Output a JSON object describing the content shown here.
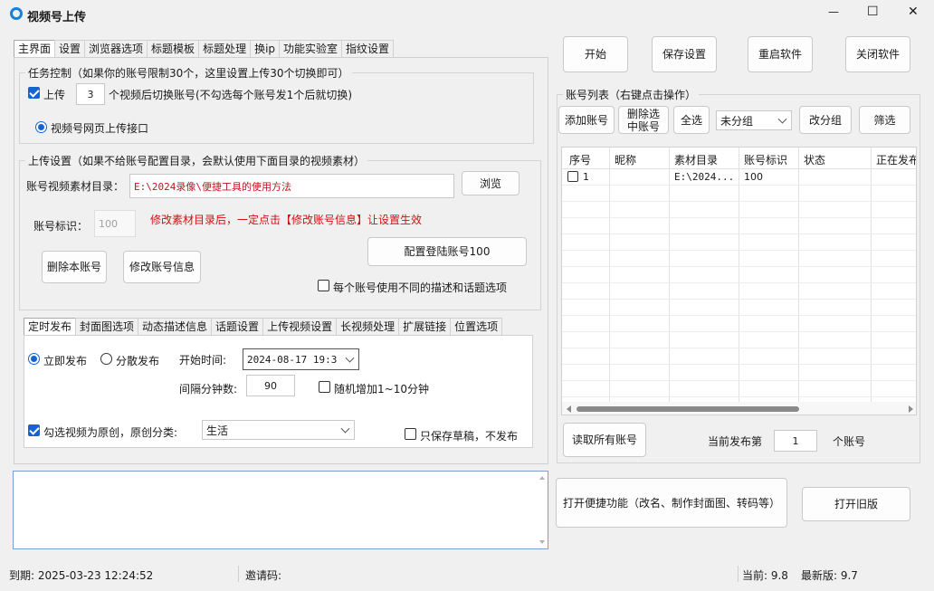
{
  "window": {
    "title": "视频号上传",
    "minimize": "—",
    "maximize": "☐",
    "close": "✕"
  },
  "main_tabs": [
    "主界面",
    "设置",
    "浏览器选项",
    "标题模板",
    "标题处理",
    "换ip",
    "功能实验室",
    "指纹设置"
  ],
  "task": {
    "title": "任务控制（如果你的账号限制30个，这里设置上传30个切换即可）",
    "upload_label": "上传",
    "upload_count": "3",
    "switch_text": "个视频后切换账号(不勾选每个账号发1个后就切换)",
    "interface_label": "视频号网页上传接口"
  },
  "upload": {
    "title": "上传设置（如果不给账号配置目录，会默认使用下面目录的视频素材）",
    "dir_label": "账号视频素材目录：",
    "dir_value": "E:\\2024录像\\便捷工具的使用方法",
    "browse": "浏览",
    "id_label": "账号标识：",
    "id_placeholder": "100",
    "warning": "修改素材目录后，一定点击【修改账号信息】让设置生效",
    "config_btn": "配置登陆账号100",
    "delete_btn": "删除本账号",
    "modify_btn": "修改账号信息",
    "diff_desc": "每个账号使用不同的描述和话题选项"
  },
  "sub_tabs": [
    "定时发布",
    "封面图选项",
    "动态描述信息",
    "话题设置",
    "上传视频设置",
    "长视频处理",
    "扩展链接",
    "位置选项"
  ],
  "schedule": {
    "now": "立即发布",
    "spread": "分散发布",
    "start_label": "开始时间:",
    "start_value": "2024-08-17 19:3",
    "interval_label": "间隔分钟数:",
    "interval_value": "90",
    "random_label": "随机增加1~10分钟",
    "original_label": "勾选视频为原创，原创分类:",
    "original_category": "生活",
    "draft_label": "只保存草稿，不发布"
  },
  "top_buttons": [
    "开始",
    "保存设置",
    "重启软件",
    "关闭软件"
  ],
  "accounts": {
    "title": "账号列表（右键点击操作）",
    "add": "添加账号",
    "delete_selected": "删除选中账号",
    "select_all": "全选",
    "group": "未分组",
    "change_group": "改分组",
    "filter": "筛选",
    "columns": [
      "序号",
      "昵称",
      "素材目录",
      "账号标识",
      "状态",
      "正在发布"
    ],
    "rows": [
      {
        "index": "1",
        "nickname": "",
        "dir": "E:\\2024...",
        "id": "100",
        "status": "",
        "publishing": ""
      }
    ],
    "read_all": "读取所有账号",
    "current_label": "当前发布第",
    "current_value": "1",
    "current_suffix": "个账号"
  },
  "bottom_buttons": {
    "tools": "打开便捷功能（改名、制作封面图、转码等）",
    "old": "打开旧版"
  },
  "status": {
    "expire": "到期:  2025-03-23 12:24:52",
    "invite": "邀请码:",
    "current_ver": "当前:  9.8",
    "latest_ver": "最新版:  9.7"
  },
  "colors": {
    "accent": "#1464d0",
    "warning": "#d01010",
    "path": "#c0141e"
  }
}
